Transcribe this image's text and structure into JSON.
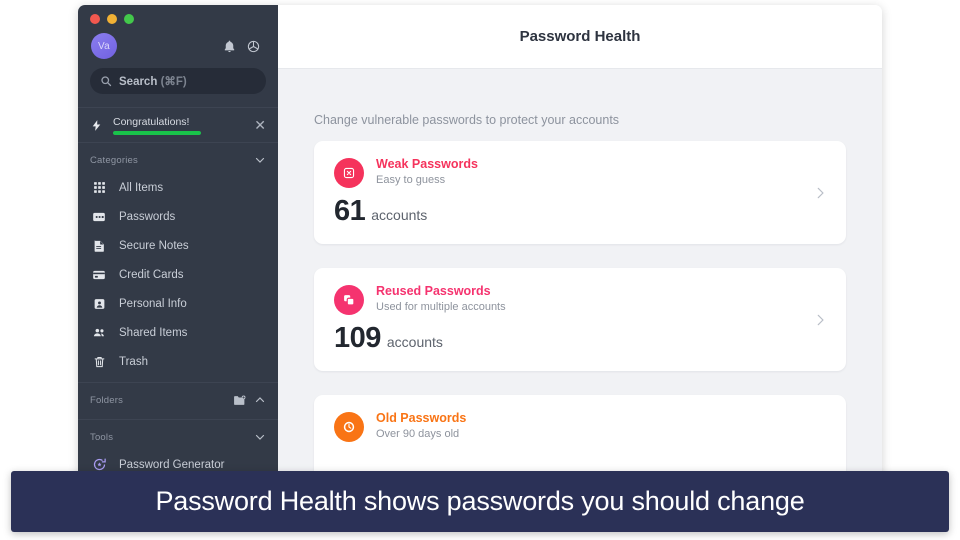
{
  "window": {
    "traffic_lights": [
      "close",
      "minimize",
      "maximize"
    ]
  },
  "sidebar": {
    "avatar_initials": "Va",
    "top_icons": [
      {
        "name": "notifications-bell-icon",
        "label": "Notifications"
      },
      {
        "name": "settings-gear-icon",
        "label": "Settings"
      }
    ],
    "search": {
      "label": "Search",
      "shortcut": "(⌘F)"
    },
    "banner": {
      "title": "Congratulations!",
      "progress_percent": 100,
      "progress_color": "#19c34a",
      "close_label": "✕"
    },
    "categories": {
      "label": "Categories",
      "items": [
        {
          "label": "All Items",
          "icon": "grid-icon"
        },
        {
          "label": "Passwords",
          "icon": "key-card-icon"
        },
        {
          "label": "Secure Notes",
          "icon": "note-icon"
        },
        {
          "label": "Credit Cards",
          "icon": "credit-card-icon"
        },
        {
          "label": "Personal Info",
          "icon": "person-badge-icon"
        },
        {
          "label": "Shared Items",
          "icon": "people-icon"
        },
        {
          "label": "Trash",
          "icon": "trash-icon"
        }
      ]
    },
    "folders": {
      "label": "Folders",
      "add_icon": "new-folder-icon",
      "collapse_icon": "chevron-up-icon"
    },
    "tools": {
      "label": "Tools",
      "expand_icon": "chevron-down-icon",
      "items": [
        {
          "label": "Password Generator",
          "icon": "password-generator-icon"
        }
      ]
    }
  },
  "main": {
    "title": "Password Health",
    "subtitle": "Change vulnerable passwords to protect your accounts",
    "cards": [
      {
        "heading": "Weak Passwords",
        "subtext": "Easy to guess",
        "count": "61",
        "count_unit": "accounts",
        "color": "#f5335c",
        "icon": "x-square-icon"
      },
      {
        "heading": "Reused Passwords",
        "subtext": "Used for multiple accounts",
        "count": "109",
        "count_unit": "accounts",
        "color": "#f5336f",
        "icon": "copy-squares-icon"
      },
      {
        "heading": "Old Passwords",
        "subtext": "Over 90 days old",
        "count": "",
        "count_unit": "",
        "color": "#f97415",
        "icon": "clock-icon"
      }
    ]
  },
  "caption": {
    "text": "Password Health shows passwords you should change",
    "background": "#2b3157"
  }
}
